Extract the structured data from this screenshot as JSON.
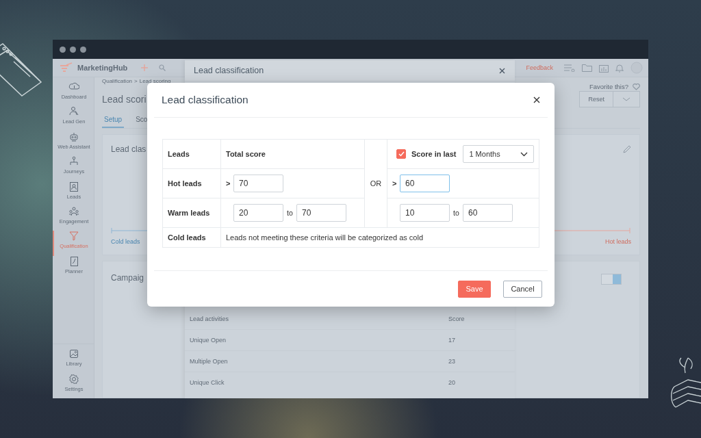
{
  "app": {
    "name": "MarketingHub"
  },
  "topbar": {
    "feedback": "Feedback"
  },
  "sidebar": {
    "items": [
      {
        "label": "Dashboard",
        "selected": false
      },
      {
        "label": "Lead Gen",
        "selected": false
      },
      {
        "label": "Web Assistant",
        "selected": false
      },
      {
        "label": "Journeys",
        "selected": false
      },
      {
        "label": "Leads",
        "selected": false
      },
      {
        "label": "Engagement",
        "selected": false
      },
      {
        "label": "Qualification",
        "selected": true
      },
      {
        "label": "Planner",
        "selected": false
      }
    ],
    "footer_items": [
      {
        "label": "Library",
        "selected": false
      },
      {
        "label": "Settings",
        "selected": false
      }
    ]
  },
  "breadcrumb": [
    "Qualification",
    "Lead scoring"
  ],
  "breadcrumb_separator": ">",
  "favorite": {
    "label": "Favorite this?"
  },
  "page_title": "Lead scori",
  "reset_button": "Reset",
  "tabs": [
    {
      "label": "Setup",
      "selected": true
    },
    {
      "label": "Sco",
      "selected": false
    }
  ],
  "cards": [
    {
      "kind": "scale",
      "title": "Lead clas",
      "scale_start": "Cold leads",
      "scale_end": "Hot leads"
    },
    {
      "kind": "toggle",
      "title": "Campaig",
      "toggle_on": true
    }
  ],
  "side_panel": {
    "title": "Lead classification",
    "table": {
      "columns": [
        "Lead activities",
        "Score"
      ],
      "rows": [
        [
          "Unique Open",
          "17"
        ],
        [
          "Multiple Open",
          "23"
        ],
        [
          "Unique Click",
          "20"
        ]
      ]
    }
  },
  "dialog": {
    "title": "Lead classification",
    "columns": {
      "leads": "Leads",
      "total": "Total score",
      "or": "OR"
    },
    "recent_header": {
      "checked": true,
      "label": "Score in last",
      "period": "1 Months"
    },
    "rows": [
      {
        "kind": "above",
        "label": "Hot leads",
        "total_sign": ">",
        "total": {
          "value": "70",
          "focused": false
        },
        "recent_sign": ">",
        "recent": {
          "value": "60",
          "focused": true
        }
      },
      {
        "kind": "range",
        "label": "Warm leads",
        "total_from": {
          "value": "20",
          "focused": false
        },
        "total_joiner": "to",
        "total_to": {
          "value": "70",
          "focused": false
        },
        "recent_from": {
          "value": "10",
          "focused": false
        },
        "recent_joiner": "to",
        "recent_to": {
          "value": "60",
          "focused": false
        }
      },
      {
        "kind": "note",
        "label": "Cold leads",
        "note": "Leads not meeting these criteria will be categorized as cold"
      }
    ],
    "buttons": [
      {
        "label": "Save",
        "kind": "primary"
      },
      {
        "label": "Cancel",
        "kind": "secondary"
      }
    ]
  }
}
